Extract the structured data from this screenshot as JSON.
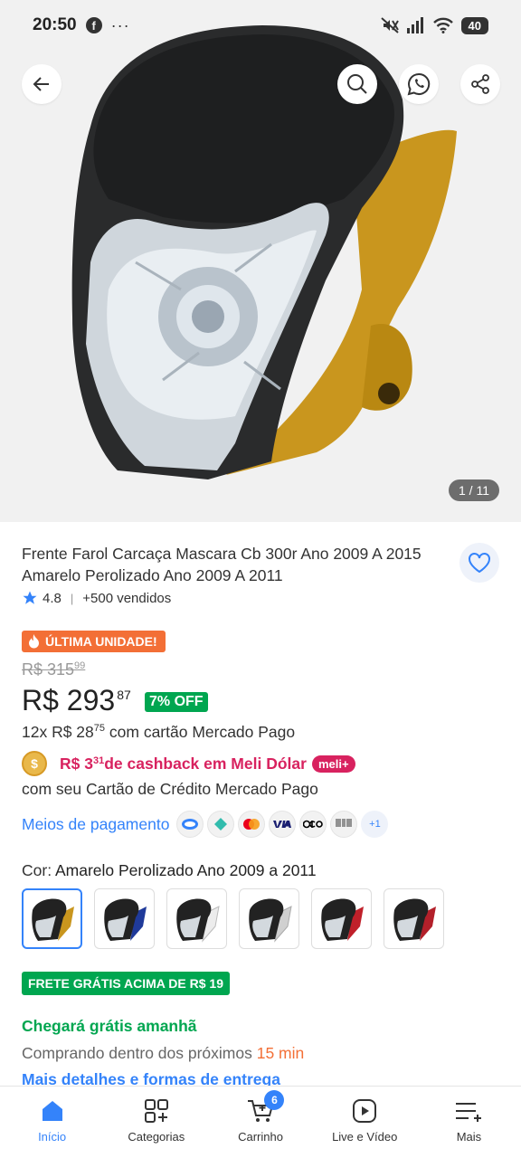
{
  "status_bar": {
    "time": "20:50",
    "app_badge": "f",
    "more": "···",
    "battery": "40"
  },
  "gallery": {
    "counter": "1 / 11"
  },
  "product": {
    "title": "Frente Farol Carcaça Mascara Cb 300r Ano 2009 A 2015 Amarelo Perolizado Ano 2009 A 2011",
    "rating": "4.8",
    "sold": "+500 vendidos",
    "badge_last_unit": "ÚLTIMA UNIDADE!",
    "old_price": "R$ 315",
    "old_price_cents": "99",
    "price": "R$ 293",
    "price_cents": "87",
    "discount": "7% OFF",
    "installments_prefix": "12x R$ 28",
    "installments_cents": "75",
    "installments_suffix": " com cartão Mercado Pago",
    "cashback_amount": "R$ 3",
    "cashback_cents": "31",
    "cashback_text": " de cashback em Meli Dólar",
    "meli_plus": "meli+",
    "cashback_sub": "com seu Cartão de Crédito Mercado Pago",
    "payment_link": "Meios de pagamento",
    "payment_more": "+1",
    "color_label": "Cor: ",
    "color_value": "Amarelo Perolizado Ano 2009 a 2011",
    "swatch_colors": [
      "#c9961e",
      "#1f3a9a",
      "#e8e8e8",
      "#d9d9d9",
      "#c0202a",
      "#b3202a"
    ],
    "free_shipping": "FRETE GRÁTIS ACIMA DE R$ 19",
    "arrival": "Chegará grátis amanhã",
    "buy_within_prefix": "Comprando dentro dos próximos ",
    "buy_within_time": "15 min",
    "more_details": "Mais detalhes e formas de entrega"
  },
  "tabs": [
    {
      "label": "Início",
      "icon": "home-icon"
    },
    {
      "label": "Categorias",
      "icon": "categories-icon"
    },
    {
      "label": "Carrinho",
      "icon": "cart-icon",
      "badge": "6"
    },
    {
      "label": "Live e Vídeo",
      "icon": "video-icon"
    },
    {
      "label": "Mais",
      "icon": "menu-icon"
    }
  ],
  "colors": {
    "brand_blue": "#3483fa",
    "green": "#00a650",
    "orange": "#f36f36",
    "pink": "#d8225f"
  }
}
